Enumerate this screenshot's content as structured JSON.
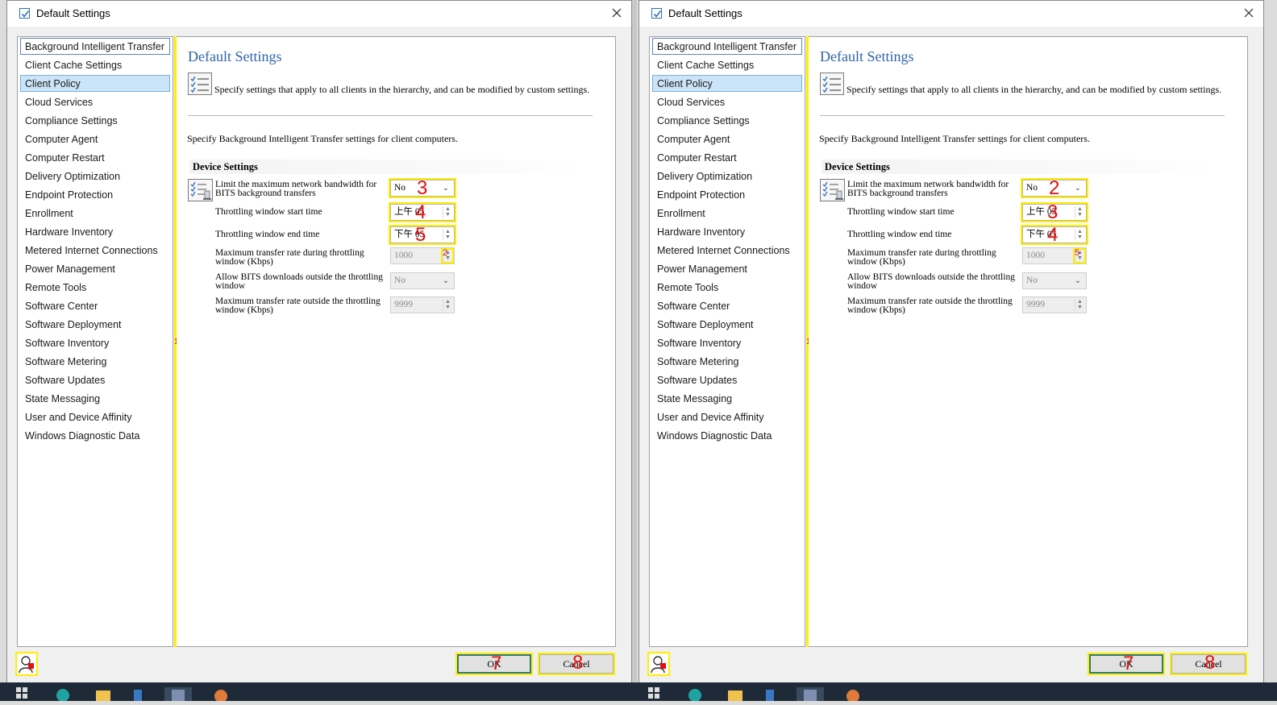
{
  "windows": [
    {
      "title": "Default Settings",
      "nav": [
        "Background Intelligent Transfer",
        "Client Cache Settings",
        "Client Policy",
        "Cloud Services",
        "Compliance Settings",
        "Computer Agent",
        "Computer Restart",
        "Delivery Optimization",
        "Endpoint Protection",
        "Enrollment",
        "Hardware Inventory",
        "Metered Internet Connections",
        "Power Management",
        "Remote Tools",
        "Software Center",
        "Software Deployment",
        "Software Inventory",
        "Software Metering",
        "Software Updates",
        "State Messaging",
        "User and Device Affinity",
        "Windows Diagnostic Data"
      ],
      "focused_index": 0,
      "selected_index": 2,
      "splitter_mark": "1",
      "panel": {
        "heading": "Default Settings",
        "description": "Specify settings that apply to all clients in the hierarchy, and can be modified by custom settings.",
        "intro": "Specify Background Intelligent Transfer settings for client computers.",
        "group_title": "Device Settings",
        "settings": {
          "limit_label": "Limit the maximum network bandwidth for BITS background transfers",
          "limit_value": "No",
          "start_label": "Throttling window start time",
          "start_value": "上午 05",
          "end_label": "Throttling window end time",
          "end_value": "下午 05",
          "max_during_label": "Maximum transfer rate during throttling window (Kbps)",
          "max_during_value": "1000",
          "allow_label": "Allow BITS downloads outside the throttling window",
          "allow_value": "No",
          "max_outside_label": "Maximum transfer rate outside the throttling window (Kbps)",
          "max_outside_value": "9999"
        }
      },
      "ok_label": "OK",
      "cancel_label": "Cancel",
      "marks": {
        "limit": "3",
        "start": "4",
        "end": "5",
        "spin": "2",
        "ok": "7",
        "cancel": "8"
      }
    },
    {
      "title": "Default Settings",
      "nav": [
        "Background Intelligent Transfer",
        "Client Cache Settings",
        "Client Policy",
        "Cloud Services",
        "Compliance Settings",
        "Computer Agent",
        "Computer Restart",
        "Delivery Optimization",
        "Endpoint Protection",
        "Enrollment",
        "Hardware Inventory",
        "Metered Internet Connections",
        "Power Management",
        "Remote Tools",
        "Software Center",
        "Software Deployment",
        "Software Inventory",
        "Software Metering",
        "Software Updates",
        "State Messaging",
        "User and Device Affinity",
        "Windows Diagnostic Data"
      ],
      "focused_index": 0,
      "selected_index": 2,
      "splitter_mark": "1",
      "panel": {
        "heading": "Default Settings",
        "description": "Specify settings that apply to all clients in the hierarchy, and can be modified by custom settings.",
        "intro": "Specify Background Intelligent Transfer settings for client computers.",
        "group_title": "Device Settings",
        "settings": {
          "limit_label": "Limit the maximum network bandwidth for BITS background transfers",
          "limit_value": "No",
          "start_label": "Throttling window start time",
          "start_value": "上午 05",
          "end_label": "Throttling window end time",
          "end_value": "下午 05",
          "max_during_label": "Maximum transfer rate during throttling window (Kbps)",
          "max_during_value": "1000",
          "allow_label": "Allow BITS downloads outside the throttling window",
          "allow_value": "No",
          "max_outside_label": "Maximum transfer rate outside the throttling window (Kbps)",
          "max_outside_value": "9999"
        }
      },
      "ok_label": "OK",
      "cancel_label": "Cancel",
      "marks": {
        "limit": "2",
        "start": "3",
        "end": "4",
        "spin": "5",
        "ok": "7",
        "cancel": "8"
      }
    }
  ],
  "colors": {
    "annotation_highlight": "#ffee00",
    "annotation_number": "#e01010",
    "heading_blue": "#2e64a8",
    "selected_bg": "#cce4f7"
  },
  "taskbar_icons": [
    "windows-icon",
    "edge-icon",
    "file-explorer-icon",
    "store-icon",
    "configmgr-console-icon",
    "app-icon"
  ]
}
